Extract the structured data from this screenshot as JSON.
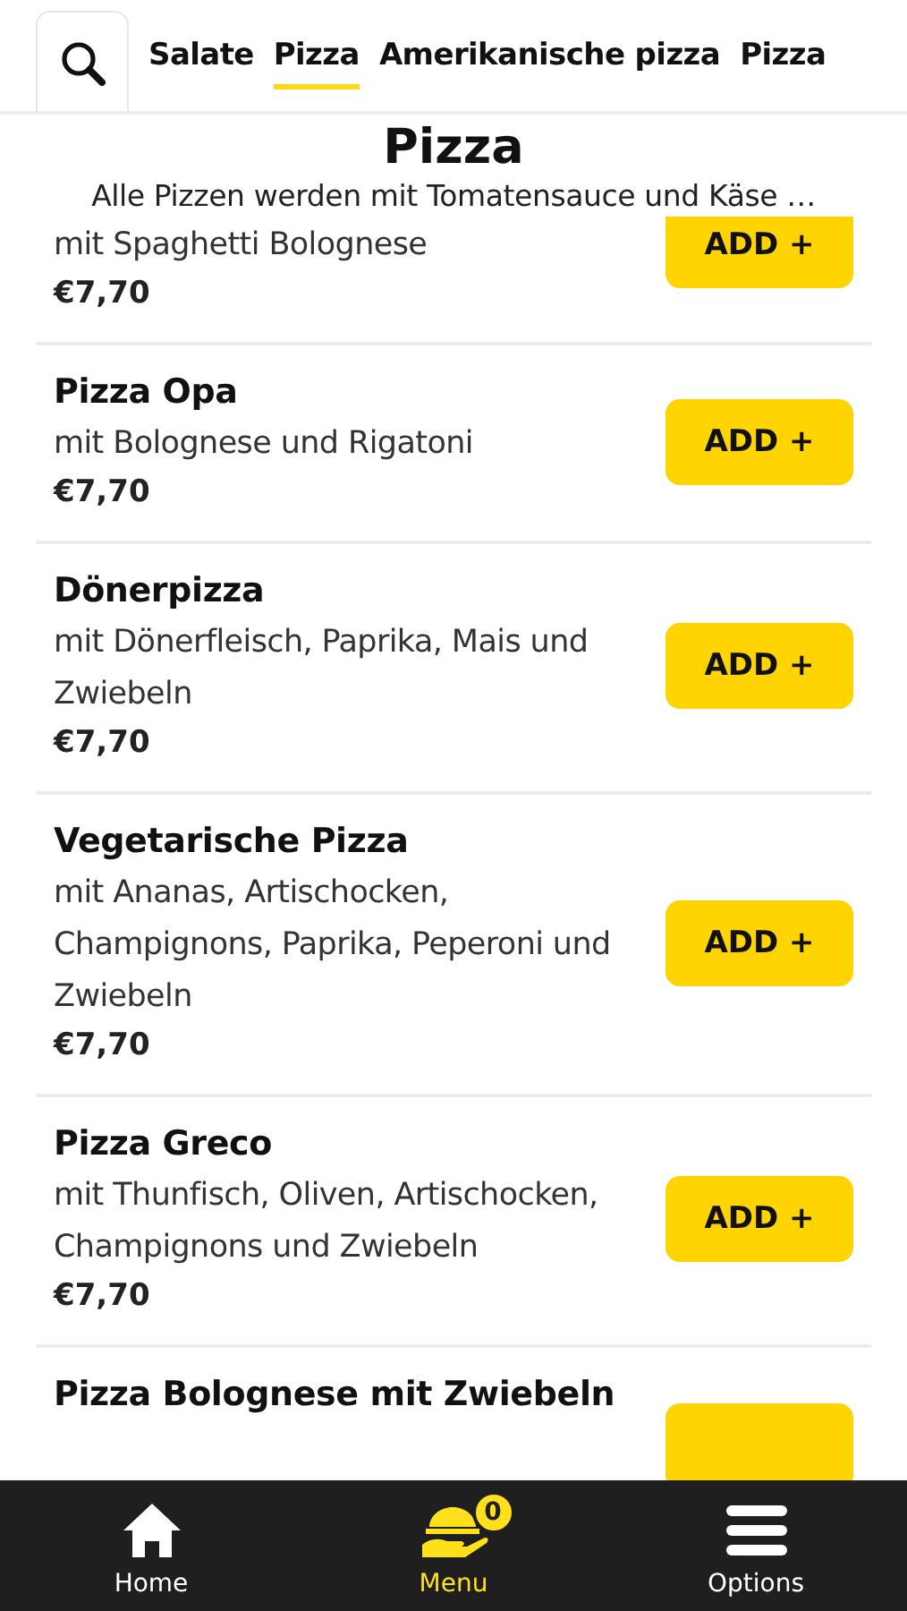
{
  "tabs": [
    {
      "label": "Salate",
      "selected": false
    },
    {
      "label": "Pizza",
      "selected": true
    },
    {
      "label": "Amerikanische pizza",
      "selected": false
    },
    {
      "label": "Pizza",
      "selected": false
    }
  ],
  "category": {
    "title": "Pizza",
    "description": "Alle Pizzen werden mit Tomatensauce und Käse …"
  },
  "items": [
    {
      "description": "mit Spaghetti Bolognese",
      "price": "€7,70",
      "button": "ADD +"
    },
    {
      "name": "Pizza Opa",
      "description": "mit Bolognese und Rigatoni",
      "price": "€7,70",
      "button": "ADD +"
    },
    {
      "name": "Dönerpizza",
      "description": "mit Dönerfleisch, Paprika, Mais und Zwiebeln",
      "price": "€7,70",
      "button": "ADD +"
    },
    {
      "name": "Vegetarische Pizza",
      "description": "mit Ananas, Artischocken, Champignons, Paprika, Peperoni und Zwiebeln",
      "price": "€7,70",
      "button": "ADD +"
    },
    {
      "name": "Pizza Greco",
      "description": "mit Thunfisch, Oliven, Artischocken, Champignons und Zwiebeln",
      "price": "€7,70",
      "button": "ADD +"
    },
    {
      "name": "Pizza Bolognese mit Zwiebeln"
    }
  ],
  "nav": [
    {
      "kind": "home",
      "label": "Home",
      "selected": false
    },
    {
      "kind": "menu",
      "label": "Menu",
      "selected": true,
      "badge": "0"
    },
    {
      "kind": "options",
      "label": "Options",
      "selected": false
    }
  ]
}
